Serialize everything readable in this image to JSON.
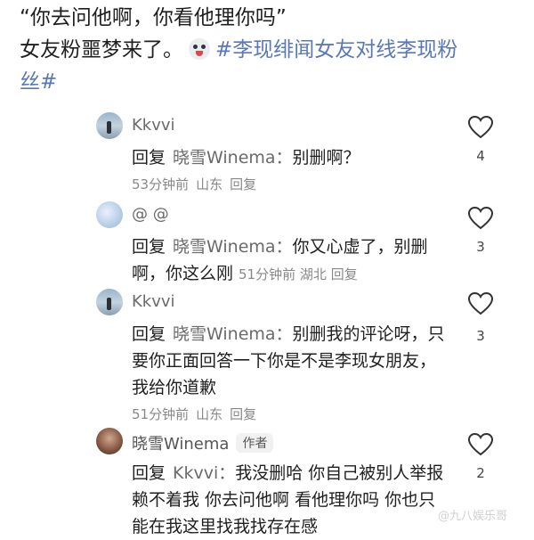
{
  "post": {
    "line1": "“你去问他啊，你看他理你吗”",
    "line2_text": "女友粉噩梦来了。",
    "emoji_icon": "laughing-dog-emoji",
    "line2_tag": "#李现绯闻女友对线李现粉",
    "line3_tag": "丝#"
  },
  "comments": [
    {
      "user": "Kkvvi",
      "avatar": "beach-avatar",
      "reply_kw": "回复",
      "mention": "晓雪Winema：",
      "text": "别删啊？",
      "time": "53分钟前",
      "location": "山东",
      "reply_link": "回复",
      "likes": "4"
    },
    {
      "user": "@ @",
      "avatar": "blue-avatar",
      "reply_kw": "回复",
      "mention": "晓雪Winema：",
      "text": "你又心虚了，别删啊，你这么刚",
      "time": "51分钟前",
      "location": "湖北",
      "reply_link": "回复",
      "likes": "3"
    },
    {
      "user": "Kkvvi",
      "avatar": "beach-avatar",
      "reply_kw": "回复",
      "mention": "晓雪Winema：",
      "text": "别删我的评论呀，只要你正面回答一下你是不是李现女朋友，我给你道歉",
      "time": "51分钟前",
      "location": "山东",
      "reply_link": "回复",
      "likes": "3"
    },
    {
      "user": "晓雪Winema",
      "badge": "作者",
      "avatar": "girl-avatar",
      "reply_kw": "回复",
      "mention": "Kkvvi：",
      "text": "我没删哈 你自己被别人举报赖不着我 你去问他啊 看他理你吗 你也只能在我这里找我找存在感",
      "likes": "2"
    }
  ],
  "watermark": "@九八娱乐哥"
}
